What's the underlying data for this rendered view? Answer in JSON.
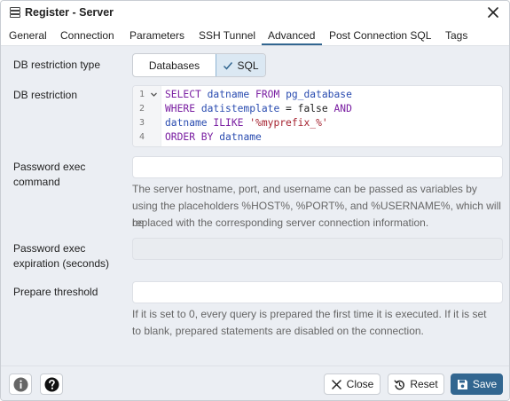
{
  "window": {
    "title": "Register - Server",
    "icon": "server-icon",
    "close_icon": "close-icon"
  },
  "tabs": [
    {
      "label": "General",
      "active": false
    },
    {
      "label": "Connection",
      "active": false
    },
    {
      "label": "Parameters",
      "active": false
    },
    {
      "label": "SSH Tunnel",
      "active": false
    },
    {
      "label": "Advanced",
      "active": true
    },
    {
      "label": "Post Connection SQL",
      "active": false
    },
    {
      "label": "Tags",
      "active": false
    }
  ],
  "form": {
    "db_restriction_type": {
      "label": "DB restriction type",
      "options": [
        "Databases",
        "SQL"
      ],
      "selected": "SQL"
    },
    "db_restriction": {
      "label": "DB restriction",
      "line_numbers": [
        "1",
        "2",
        "3",
        "4"
      ]
    },
    "password_exec_command": {
      "label_line1": "Password exec",
      "label_line2": "command",
      "value": "",
      "help_line1": "The server hostname, port, and username can be passed as variables by",
      "help_line2": "using the placeholders %HOST%, %PORT%, and %USERNAME%, which will be",
      "help_line3": "replaced with the corresponding server connection information."
    },
    "password_exec_expiration": {
      "label_line1": "Password exec",
      "label_line2": "expiration (seconds)",
      "value": "",
      "disabled": true
    },
    "prepare_threshold": {
      "label": "Prepare threshold",
      "value": "",
      "help_line1": "If it is set to 0, every query is prepared the first time it is executed. If it is set",
      "help_line2": "to blank, prepared statements are disabled on the connection."
    }
  },
  "footer": {
    "info_icon": "info-icon",
    "help_icon": "help-icon",
    "close_label": "Close",
    "reset_label": "Reset",
    "save_label": "Save"
  },
  "colors": {
    "accent": "#326690",
    "background": "#ebeef3",
    "selected_segment": "#dbe8f3",
    "sql_keyword": "#7a1fa2",
    "sql_identifier": "#2a4cb0",
    "sql_string": "#a5222f"
  }
}
